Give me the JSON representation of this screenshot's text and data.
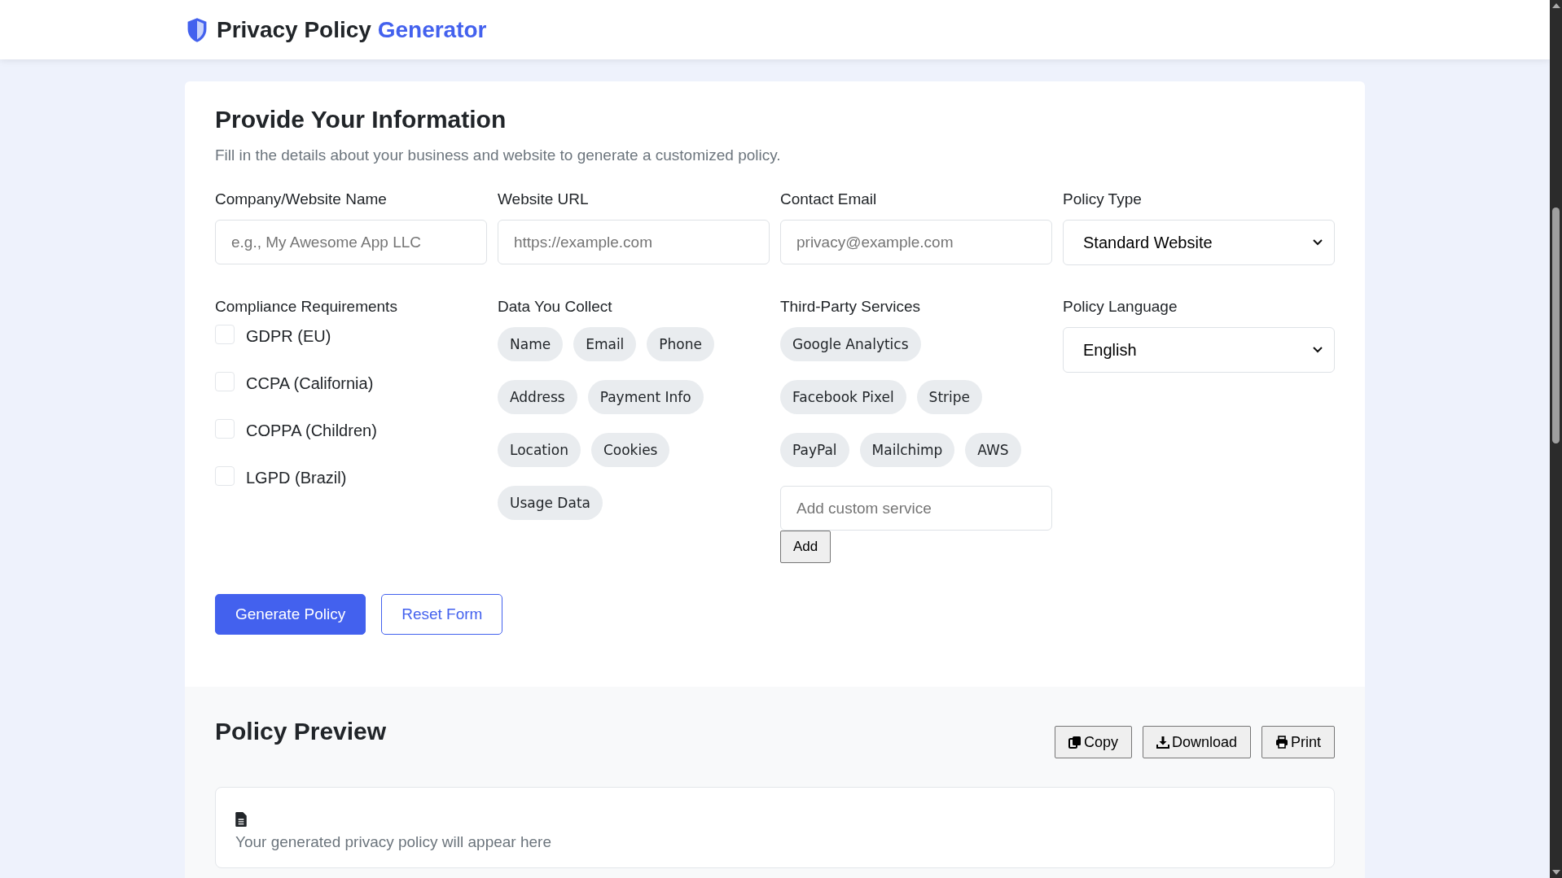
{
  "header": {
    "title": "Privacy Policy",
    "title_accent": "Generator"
  },
  "form": {
    "title": "Provide Your Information",
    "subtitle": "Fill in the details about your business and website to generate a customized policy.",
    "fields": [
      {
        "label": "Company/Website Name",
        "kind": "input",
        "placeholder": "e.g., My Awesome App LLC"
      },
      {
        "label": "Website URL",
        "kind": "input",
        "placeholder": "https://example.com"
      },
      {
        "label": "Contact Email",
        "kind": "input",
        "placeholder": "privacy@example.com"
      },
      {
        "label": "Policy Type",
        "kind": "select",
        "value": "Standard Website"
      }
    ],
    "compliance": {
      "label": "Compliance Requirements",
      "options": [
        {
          "label": "GDPR (EU)",
          "checked": false
        },
        {
          "label": "CCPA (California)",
          "checked": false
        },
        {
          "label": "COPPA (Children)",
          "checked": false
        },
        {
          "label": "LGPD (Brazil)",
          "checked": false
        }
      ]
    },
    "data_collected": {
      "label": "Data You Collect",
      "rows": [
        [
          {
            "label": "Name",
            "selected": false
          },
          {
            "label": "Email",
            "selected": false
          },
          {
            "label": "Phone",
            "selected": false
          }
        ],
        [
          {
            "label": "Address",
            "selected": false
          },
          {
            "label": "Payment Info",
            "selected": false
          }
        ],
        [
          {
            "label": "Location",
            "selected": false
          },
          {
            "label": "Cookies",
            "selected": false
          }
        ],
        [
          {
            "label": "Usage Data",
            "selected": false
          }
        ]
      ]
    },
    "services": {
      "label": "Third-Party Services",
      "rows": [
        [
          {
            "label": "Google Analytics",
            "selected": false
          }
        ],
        [
          {
            "label": "Facebook Pixel",
            "selected": false
          },
          {
            "label": "Stripe",
            "selected": false
          }
        ],
        [
          {
            "label": "PayPal",
            "selected": false
          },
          {
            "label": "Mailchimp",
            "selected": false
          },
          {
            "label": "AWS",
            "selected": false
          }
        ]
      ],
      "custom_placeholder": "Add custom service",
      "add_button": "Add"
    },
    "language": {
      "label": "Policy Language",
      "value": "English"
    },
    "buttons": [
      {
        "label": "Generate Policy",
        "kind": "primary"
      },
      {
        "label": "Reset Form",
        "kind": "outline"
      }
    ]
  },
  "preview": {
    "title": "Policy Preview",
    "actions": [
      {
        "label": "Copy",
        "kind": "copy"
      },
      {
        "label": "Download",
        "kind": "download"
      },
      {
        "label": "Print",
        "kind": "print"
      }
    ],
    "empty_text": "Your generated privacy policy will appear here"
  }
}
